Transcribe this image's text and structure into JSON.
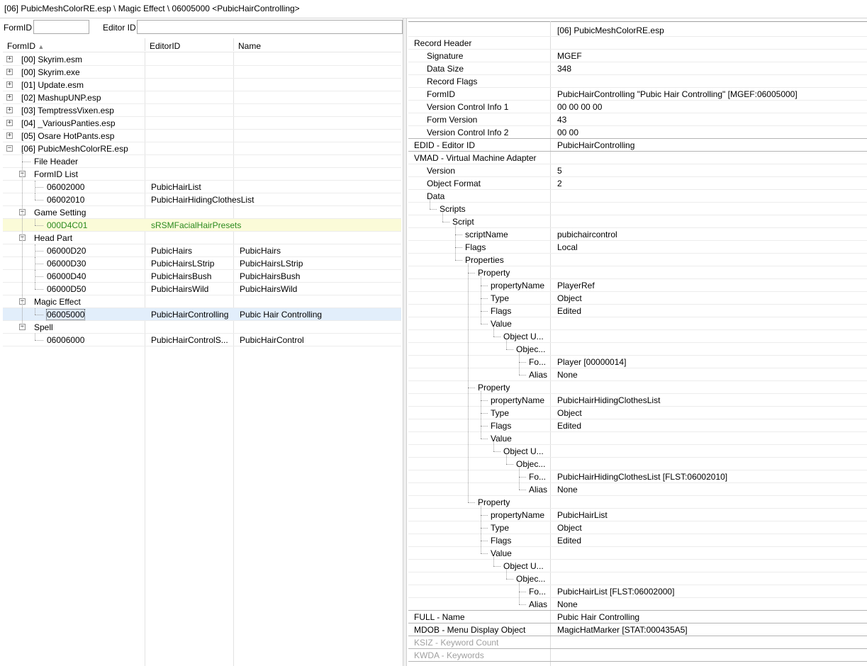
{
  "titlebar": {
    "path": "[06] PubicMeshColorRE.esp \\ Magic Effect \\ 06005000 <PubicHairControlling>"
  },
  "filter": {
    "formid_label": "FormID",
    "editorid_label": "Editor ID",
    "formid_value": "",
    "editorid_value": ""
  },
  "left_columns": {
    "formid": "FormID",
    "sort_glyph": "▲",
    "editorid": "EditorID",
    "name": "Name"
  },
  "left_rows": [
    {
      "kind": "file",
      "formid": "[00] Skyrim.esm",
      "editorid": "",
      "name": "",
      "expand": "+"
    },
    {
      "kind": "file",
      "formid": "[00] Skyrim.exe",
      "editorid": "",
      "name": "",
      "expand": "+"
    },
    {
      "kind": "file",
      "formid": "[01] Update.esm",
      "editorid": "",
      "name": "",
      "expand": "+"
    },
    {
      "kind": "file",
      "formid": "[02] MashupUNP.esp",
      "editorid": "",
      "name": "",
      "expand": "+"
    },
    {
      "kind": "file",
      "formid": "[03] TemptressVixen.esp",
      "editorid": "",
      "name": "",
      "expand": "+"
    },
    {
      "kind": "file",
      "formid": "[04] _VariousPanties.esp",
      "editorid": "",
      "name": "",
      "expand": "+"
    },
    {
      "kind": "file",
      "formid": "[05] Osare HotPants.esp",
      "editorid": "",
      "name": "",
      "expand": "+"
    },
    {
      "kind": "file",
      "formid": "[06] PubicMeshColorRE.esp",
      "editorid": "",
      "name": "",
      "expand": "−"
    },
    {
      "kind": "group",
      "formid": "File Header",
      "editorid": "",
      "name": ""
    },
    {
      "kind": "group",
      "formid": "FormID List",
      "editorid": "",
      "name": "",
      "expand": "−"
    },
    {
      "kind": "rec",
      "formid": "06002000",
      "editorid": "PubicHairList",
      "name": ""
    },
    {
      "kind": "rec",
      "formid": "06002010",
      "editorid": "PubicHairHidingClothesList",
      "name": "",
      "last": true
    },
    {
      "kind": "group",
      "formid": "Game Setting",
      "editorid": "",
      "name": "",
      "expand": "−"
    },
    {
      "kind": "rec",
      "formid": "000D4C01",
      "editorid": "sRSMFacialHairPresets",
      "name": "",
      "last": true,
      "state": "hl"
    },
    {
      "kind": "group",
      "formid": "Head Part",
      "editorid": "",
      "name": "",
      "expand": "−"
    },
    {
      "kind": "rec",
      "formid": "06000D20",
      "editorid": "PubicHairs",
      "name": "PubicHairs"
    },
    {
      "kind": "rec",
      "formid": "06000D30",
      "editorid": "PubicHairsLStrip",
      "name": "PubicHairsLStrip"
    },
    {
      "kind": "rec",
      "formid": "06000D40",
      "editorid": "PubicHairsBush",
      "name": "PubicHairsBush"
    },
    {
      "kind": "rec",
      "formid": "06000D50",
      "editorid": "PubicHairsWild",
      "name": "PubicHairsWild",
      "last": true
    },
    {
      "kind": "group",
      "formid": "Magic Effect",
      "editorid": "",
      "name": "",
      "expand": "−"
    },
    {
      "kind": "rec",
      "formid": "06005000",
      "editorid": "PubicHairControlling",
      "name": "Pubic Hair Controlling",
      "last": true,
      "state": "sel"
    },
    {
      "kind": "group",
      "formid": "Spell",
      "editorid": "",
      "name": "",
      "expand": "−",
      "lastgroup": true
    },
    {
      "kind": "rec",
      "formid": "06006000",
      "editorid": "PubicHairControlS...",
      "name": "PubicHairControl",
      "last": true
    }
  ],
  "right_header": {
    "file": "[06] PubicMeshColorRE.esp"
  },
  "right_rows": [
    {
      "label": "Record Header",
      "value": "",
      "depth": 0
    },
    {
      "label": "Signature",
      "value": "MGEF",
      "depth": 1
    },
    {
      "label": "Data Size",
      "value": "348",
      "depth": 1
    },
    {
      "label": "Record Flags",
      "value": "",
      "depth": 1
    },
    {
      "label": "FormID",
      "value": "PubicHairControlling \"Pubic Hair Controlling\" [MGEF:06005000]",
      "depth": 1
    },
    {
      "label": "Version Control Info 1",
      "value": "00 00 00 00",
      "depth": 1
    },
    {
      "label": "Form Version",
      "value": "43",
      "depth": 1
    },
    {
      "label": "Version Control Info 2",
      "value": "00 00",
      "depth": 1,
      "sec": true
    },
    {
      "label": "EDID - Editor ID",
      "value": "PubicHairControlling",
      "depth": 0,
      "sec": true
    },
    {
      "label": "VMAD - Virtual Machine Adapter",
      "value": "",
      "depth": 0
    },
    {
      "label": "Version",
      "value": "5",
      "depth": 1
    },
    {
      "label": "Object Format",
      "value": "2",
      "depth": 1
    },
    {
      "label": "Data",
      "value": "",
      "depth": 1
    },
    {
      "label": "Scripts",
      "value": "",
      "depth": 2
    },
    {
      "label": "Script",
      "value": "",
      "depth": 3
    },
    {
      "label": "scriptName",
      "value": "pubichaircontrol",
      "depth": 4
    },
    {
      "label": "Flags",
      "value": "Local",
      "depth": 4
    },
    {
      "label": "Properties",
      "value": "",
      "depth": 4
    },
    {
      "label": "Property",
      "value": "",
      "depth": 5
    },
    {
      "label": "propertyName",
      "value": "PlayerRef",
      "depth": 6
    },
    {
      "label": "Type",
      "value": "Object",
      "depth": 6
    },
    {
      "label": "Flags",
      "value": "Edited",
      "depth": 6
    },
    {
      "label": "Value",
      "value": "",
      "depth": 6
    },
    {
      "label": "Object U...",
      "value": "",
      "depth": 7
    },
    {
      "label": "Objec...",
      "value": "",
      "depth": 8
    },
    {
      "label": "Fo...",
      "value": "Player [00000014]",
      "depth": 9
    },
    {
      "label": "Alias",
      "value": "None",
      "depth": 9
    },
    {
      "label": "Property",
      "value": "",
      "depth": 5
    },
    {
      "label": "propertyName",
      "value": "PubicHairHidingClothesList",
      "depth": 6
    },
    {
      "label": "Type",
      "value": "Object",
      "depth": 6
    },
    {
      "label": "Flags",
      "value": "Edited",
      "depth": 6
    },
    {
      "label": "Value",
      "value": "",
      "depth": 6
    },
    {
      "label": "Object U...",
      "value": "",
      "depth": 7
    },
    {
      "label": "Objec...",
      "value": "",
      "depth": 8
    },
    {
      "label": "Fo...",
      "value": "PubicHairHidingClothesList [FLST:06002010]",
      "depth": 9
    },
    {
      "label": "Alias",
      "value": "None",
      "depth": 9
    },
    {
      "label": "Property",
      "value": "",
      "depth": 5
    },
    {
      "label": "propertyName",
      "value": "PubicHairList",
      "depth": 6
    },
    {
      "label": "Type",
      "value": "Object",
      "depth": 6
    },
    {
      "label": "Flags",
      "value": "Edited",
      "depth": 6
    },
    {
      "label": "Value",
      "value": "",
      "depth": 6
    },
    {
      "label": "Object U...",
      "value": "",
      "depth": 7
    },
    {
      "label": "Objec...",
      "value": "",
      "depth": 8
    },
    {
      "label": "Fo...",
      "value": "PubicHairList [FLST:06002000]",
      "depth": 9
    },
    {
      "label": "Alias",
      "value": "None",
      "depth": 9,
      "sec": true
    },
    {
      "label": "FULL - Name",
      "value": "Pubic Hair Controlling",
      "depth": 0,
      "sec": true
    },
    {
      "label": "MDOB - Menu Display Object",
      "value": "MagicHatMarker [STAT:000435A5]",
      "depth": 0,
      "sec": true
    },
    {
      "label": "KSIZ - Keyword Count",
      "value": "",
      "depth": 0,
      "disabled": true,
      "sec": true
    },
    {
      "label": "KWDA - Keywords",
      "value": "",
      "depth": 0,
      "disabled": true,
      "sec": true
    }
  ],
  "colors": {
    "highlight_row": "#fbfbd8",
    "highlight_text": "#2b8a1e",
    "selected_row": "#e2eefb",
    "disabled_text": "#a0a0a0"
  }
}
